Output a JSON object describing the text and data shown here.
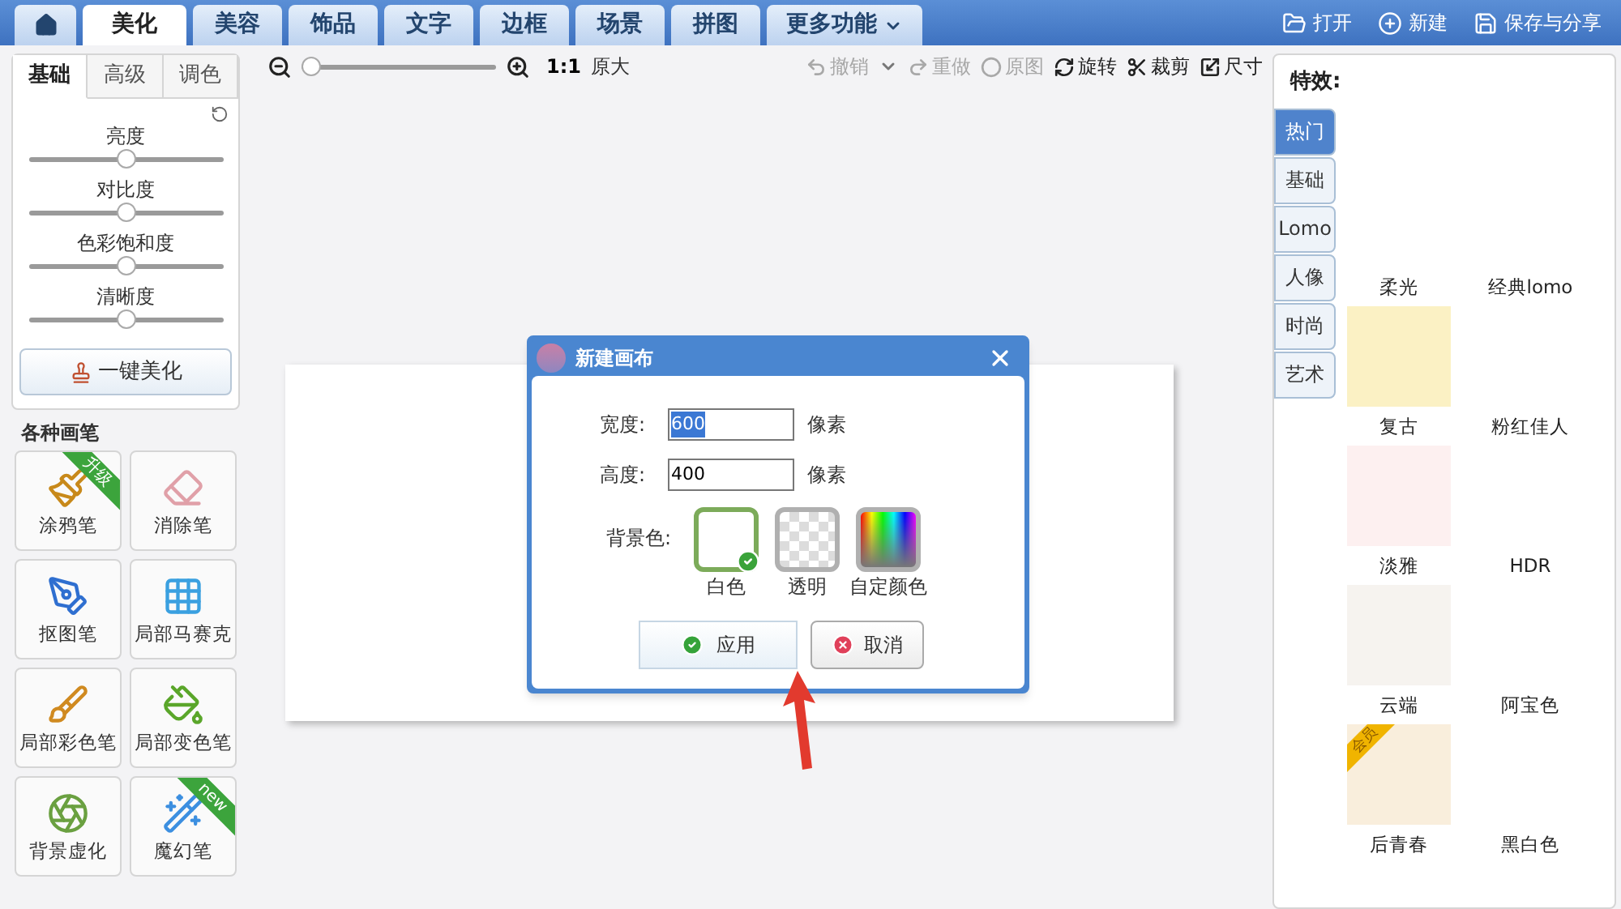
{
  "top_tabs": [
    {
      "label": "美化",
      "kind": "tab",
      "selected": true
    },
    {
      "label": "美容",
      "kind": "tab",
      "selected": false
    },
    {
      "label": "饰品",
      "kind": "tab",
      "selected": false
    },
    {
      "label": "文字",
      "kind": "tab",
      "selected": false
    },
    {
      "label": "边框",
      "kind": "tab",
      "selected": false
    },
    {
      "label": "场景",
      "kind": "tab",
      "selected": false
    },
    {
      "label": "拼图",
      "kind": "tab",
      "selected": false
    },
    {
      "label": "更多功能",
      "kind": "menu",
      "selected": false
    }
  ],
  "top_actions": [
    {
      "label": "打开",
      "kind": "open"
    },
    {
      "label": "新建",
      "kind": "new"
    },
    {
      "label": "保存与分享",
      "kind": "save"
    }
  ],
  "left_tabs": [
    {
      "label": "基础",
      "selected": true
    },
    {
      "label": "高级",
      "selected": false
    },
    {
      "label": "调色",
      "selected": false
    }
  ],
  "adjustments": [
    {
      "label": "亮度",
      "level": 0.5
    },
    {
      "label": "对比度",
      "level": 0.5
    },
    {
      "label": "色彩饱和度",
      "level": 0.5
    },
    {
      "label": "清晰度",
      "level": 0.5
    }
  ],
  "auto_button": "一键美化",
  "brushes_title": "各种画笔",
  "brushes": [
    {
      "label": "涂鸦笔",
      "kind": "doodle",
      "badge": "升级"
    },
    {
      "label": "消除笔",
      "kind": "eraser"
    },
    {
      "label": "抠图笔",
      "kind": "cutout"
    },
    {
      "label": "局部马赛克",
      "kind": "mosaic"
    },
    {
      "label": "局部彩色笔",
      "kind": "color"
    },
    {
      "label": "局部变色笔",
      "kind": "recolor"
    },
    {
      "label": "背景虚化",
      "kind": "blur"
    },
    {
      "label": "魔幻笔",
      "kind": "magic",
      "badge": "new"
    }
  ],
  "zoom": {
    "level": 0,
    "ratio": "1:1",
    "label": "原大"
  },
  "toolbar": [
    {
      "label": "撤销",
      "kind": "undo",
      "disabled": true
    },
    {
      "label": "重做",
      "kind": "redo",
      "disabled": true
    },
    {
      "label": "原图",
      "kind": "original",
      "disabled": true
    },
    {
      "label": "旋转",
      "kind": "rotate",
      "disabled": false
    },
    {
      "label": "裁剪",
      "kind": "crop",
      "disabled": false
    },
    {
      "label": "尺寸",
      "kind": "resize",
      "disabled": false
    }
  ],
  "dialog": {
    "title": "新建画布",
    "fields": [
      {
        "label": "宽度:",
        "value": "600",
        "unit": "像素",
        "selected": true
      },
      {
        "label": "高度:",
        "value": "400",
        "unit": "像素",
        "selected": false
      }
    ],
    "background_label": "背景色:",
    "backgrounds": [
      {
        "label": "白色",
        "kind": "white",
        "selected": true
      },
      {
        "label": "透明",
        "kind": "transparent",
        "selected": false
      },
      {
        "label": "自定颜色",
        "kind": "custom",
        "selected": false
      }
    ],
    "buttons": [
      {
        "label": "应用",
        "kind": "apply"
      },
      {
        "label": "取消",
        "kind": "cancel"
      }
    ]
  },
  "effects": {
    "title": "特效:",
    "tabs": [
      {
        "label": "热门",
        "selected": true
      },
      {
        "label": "基础",
        "selected": false
      },
      {
        "label": "Lomo",
        "selected": false
      },
      {
        "label": "人像",
        "selected": false
      },
      {
        "label": "时尚",
        "selected": false
      },
      {
        "label": "艺术",
        "selected": false
      }
    ],
    "items": [
      {
        "label": "柔光"
      },
      {
        "label": "经典lomo"
      },
      {
        "label": "复古",
        "color": "#fbf1c4"
      },
      {
        "label": "粉红佳人"
      },
      {
        "label": "淡雅",
        "color": "#fdf0f0"
      },
      {
        "label": "HDR"
      },
      {
        "label": "云端",
        "color": "#f6f3ef"
      },
      {
        "label": "阿宝色"
      },
      {
        "label": "后青春",
        "color": "#f9eedc",
        "badge": "会员"
      },
      {
        "label": "黑白色"
      }
    ]
  }
}
